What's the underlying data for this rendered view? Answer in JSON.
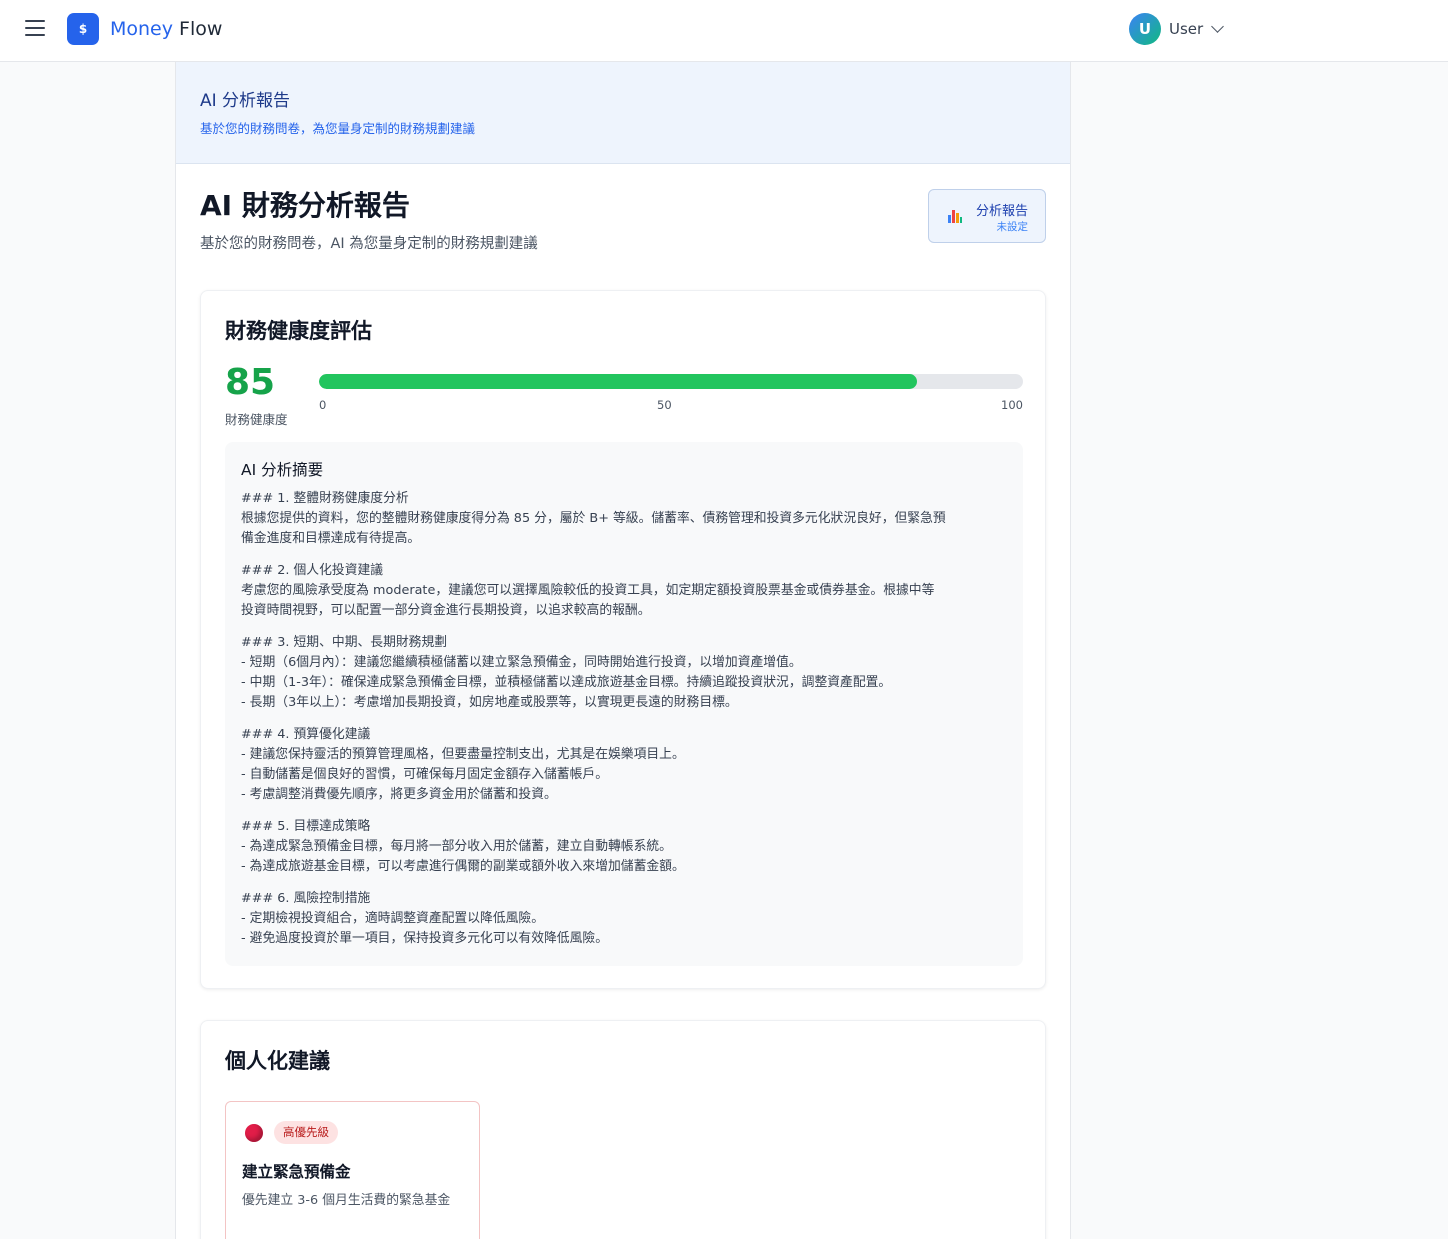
{
  "nav": {
    "brand_part1": "Money",
    "brand_part2": "Flow",
    "logo_glyph": "$",
    "user_initial": "U",
    "user_name": "User"
  },
  "banner": {
    "title": "AI 分析報告",
    "subtitle": "基於您的財務問卷，為您量身定制的財務規劃建議"
  },
  "report": {
    "title": "AI 財務分析報告",
    "subtitle": "基於您的財務問卷，AI 為您量身定制的財務規劃建議",
    "button_label": "分析報告",
    "button_status": "未設定"
  },
  "health": {
    "title": "財務健康度評估",
    "score": "85",
    "score_value": 85,
    "score_max": 100,
    "score_label": "財務健康度",
    "ticks": [
      "0",
      "50",
      "100"
    ],
    "bar_color": "#22c55e"
  },
  "summary": {
    "title": "AI 分析摘要",
    "sections": [
      {
        "heading": "### 1. 整體財務健康度分析",
        "lines": [
          "根據您提供的資料，您的整體財務健康度得分為 85 分，屬於 B+ 等級。儲蓄率、債務管理和投資多元化狀況良好，但緊急預",
          "備金進度和目標達成有待提高。"
        ]
      },
      {
        "heading": "### 2. 個人化投資建議",
        "lines": [
          "考慮您的風險承受度為 moderate，建議您可以選擇風險較低的投資工具，如定期定額投資股票基金或債券基金。根據中等",
          "投資時間視野，可以配置一部分資金進行長期投資，以追求較高的報酬。"
        ]
      },
      {
        "heading": "### 3. 短期、中期、長期財務規劃",
        "lines": [
          "- 短期（6個月內）：建議您繼續積極儲蓄以建立緊急預備金，同時開始進行投資，以增加資產增值。",
          "- 中期（1-3年）：確保達成緊急預備金目標，並積極儲蓄以達成旅遊基金目標。持續追蹤投資狀況，調整資產配置。",
          "- 長期（3年以上）：考慮增加長期投資，如房地產或股票等，以實現更長遠的財務目標。"
        ]
      },
      {
        "heading": "### 4. 預算優化建議",
        "lines": [
          "- 建議您保持靈活的預算管理風格，但要盡量控制支出，尤其是在娛樂項目上。",
          "- 自動儲蓄是個良好的習慣，可確保每月固定金額存入儲蓄帳戶。",
          "- 考慮調整消費優先順序，將更多資金用於儲蓄和投資。"
        ]
      },
      {
        "heading": "### 5. 目標達成策略",
        "lines": [
          "- 為達成緊急預備金目標，每月將一部分收入用於儲蓄，建立自動轉帳系統。",
          "- 為達成旅遊基金目標，可以考慮進行偶爾的副業或額外收入來增加儲蓄金額。"
        ]
      },
      {
        "heading": "### 6. 風險控制措施",
        "lines": [
          "- 定期檢視投資組合，適時調整資產配置以降低風險。",
          "- 避免過度投資於單一項目，保持投資多元化可以有效降低風險。"
        ]
      }
    ]
  },
  "recommendations": {
    "title": "個人化建議",
    "items": [
      {
        "badge": "高優先級",
        "title": "建立緊急預備金",
        "description": "優先建立 3-6 個月生活費的緊急基金"
      }
    ]
  }
}
